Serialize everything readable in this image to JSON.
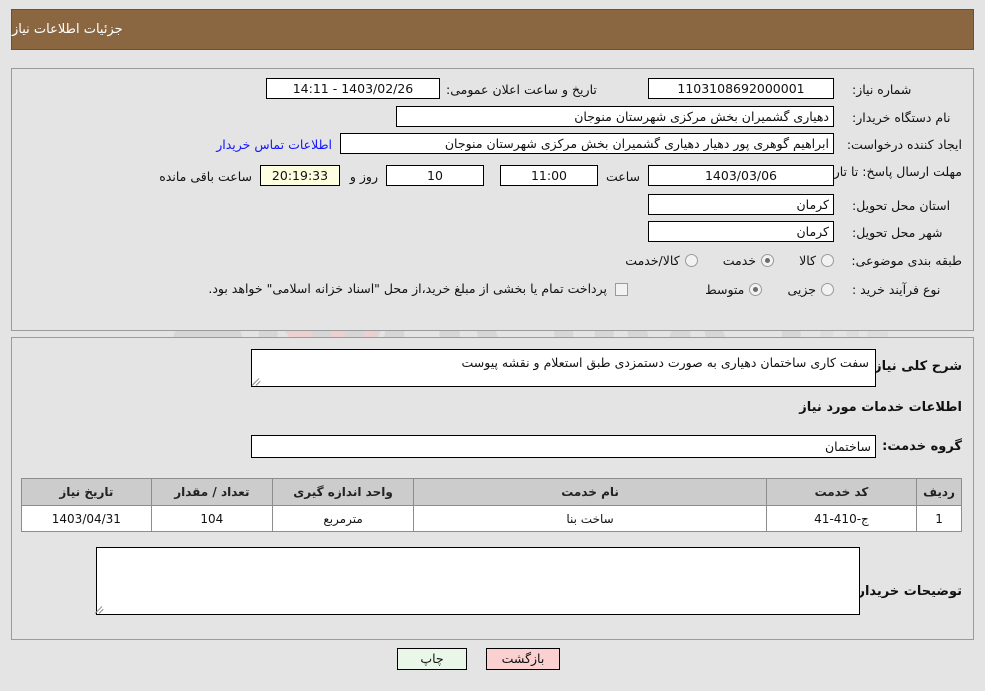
{
  "header": {
    "title": "جزئیات اطلاعات نیاز"
  },
  "top_panel": {
    "need_number_label": "شماره نیاز:",
    "need_number_value": "1103108692000001",
    "announce_label": "تاریخ و ساعت اعلان عمومی:",
    "announce_value": "1403/02/26 - 14:11",
    "buyer_org_label": "نام دستگاه خریدار:",
    "buyer_org_value": "دهیاری گشمیران بخش مرکزی شهرستان منوجان",
    "creator_label": "ایجاد کننده درخواست:",
    "creator_value": "ابراهیم گوهری پور دهیار دهیاری گشمیران بخش مرکزی شهرستان منوجان",
    "contact_link": "اطلاعات تماس خریدار",
    "deadline_label": "مهلت ارسال پاسخ: تا تاریخ:",
    "deadline_date": "1403/03/06",
    "hour_label": "ساعت",
    "deadline_time": "11:00",
    "days_remaining": "10",
    "days_word": "روز و",
    "countdown": "20:19:33",
    "remaining_suffix": "ساعت باقی مانده",
    "province_label": "استان محل تحویل:",
    "province_value": "کرمان",
    "city_label": "شهر محل تحویل:",
    "city_value": "کرمان",
    "category_label": "طبقه بندی موضوعی:",
    "category_options": [
      {
        "label": "کالا",
        "selected": false
      },
      {
        "label": "خدمت",
        "selected": true
      },
      {
        "label": "کالا/خدمت",
        "selected": false
      }
    ],
    "process_label": "نوع فرآیند خرید :",
    "process_options": [
      {
        "label": "جزیی",
        "selected": false
      },
      {
        "label": "متوسط",
        "selected": true
      }
    ],
    "treasury_checkbox_label": "پرداخت تمام یا بخشی از مبلغ خرید،از محل \"اسناد خزانه اسلامی\" خواهد بود.",
    "treasury_checked": false
  },
  "bottom_panel": {
    "general_desc_label": "شرح کلی نیاز:",
    "general_desc_value": "سفت کاری ساختمان دهیاری به صورت دستمزدی طبق استعلام و نقشه پیوست",
    "services_heading": "اطلاعات خدمات مورد نیاز",
    "service_group_label": "گروه خدمت:",
    "service_group_value": "ساختمان",
    "table": {
      "headers": [
        "ردیف",
        "کد خدمت",
        "نام خدمت",
        "واحد اندازه گیری",
        "تعداد / مقدار",
        "تاریخ نیاز"
      ],
      "rows": [
        [
          "1",
          "ج-410-41",
          "ساخت بنا",
          "مترمربع",
          "104",
          "1403/04/31"
        ]
      ]
    },
    "buyer_notes_label": "توضیحات خریدار:",
    "buyer_notes_value": ""
  },
  "footer": {
    "print_label": "چاپ",
    "back_label": "بازگشت"
  },
  "watermark": {
    "text": "AriaTender.net"
  },
  "colors": {
    "header_bar": "#8a6741",
    "link": "#1414ff",
    "back_button": "#fad0d0",
    "print_button": "#e9f7e9"
  }
}
